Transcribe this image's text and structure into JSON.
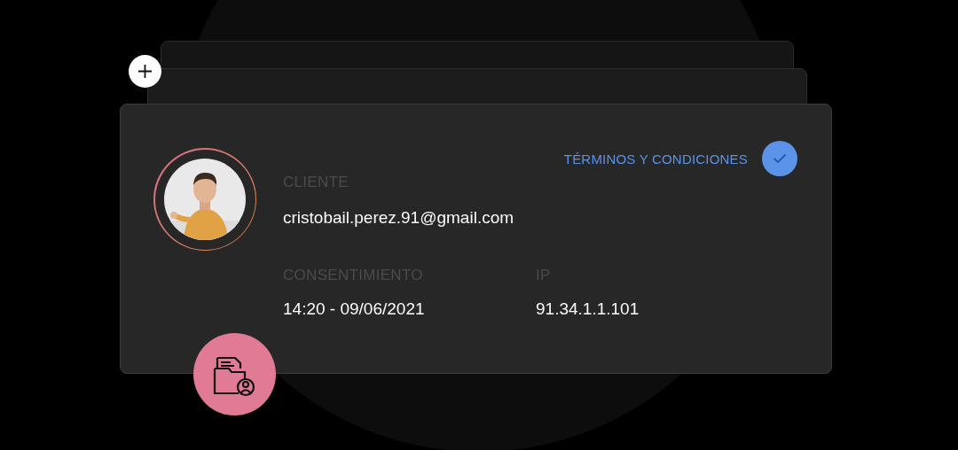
{
  "terms": {
    "label": "TÉRMINOS Y CONDICIONES",
    "checked": true
  },
  "client": {
    "label": "CLIENTE",
    "value": "cristobail.perez.91@gmail.com"
  },
  "details": [
    {
      "label": "CONSENTIMIENTO",
      "value": "14:20 - 09/06/2021"
    },
    {
      "label": "IP",
      "value": "91.34.1.1.101"
    }
  ]
}
